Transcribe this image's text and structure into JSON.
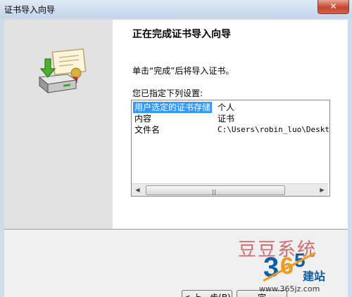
{
  "window": {
    "title": "证书导入向导",
    "close_glyph": "✕"
  },
  "wizard": {
    "heading": "正在完成证书导入向导",
    "instruction": "单击“完成”后将导入证书。",
    "listbox_label": "您已指定下列设置:",
    "settings": [
      {
        "name": "用户选定的证书存储",
        "value": "个人",
        "selected": true
      },
      {
        "name": "内容",
        "value": "证书",
        "selected": false
      },
      {
        "name": "文件名",
        "value": "C:\\Users\\robin_luo\\Desktop\\",
        "selected": false
      }
    ],
    "icons": {
      "graphic": "certificate-import-icon",
      "scroll_left": "scroll-left-arrow-icon",
      "scroll_right": "scroll-right-arrow-icon"
    }
  },
  "buttons": {
    "back": "< 上一步(B)",
    "finish": "完"
  },
  "watermark": {
    "title": "豆豆系统",
    "brand": "建站",
    "url": "www.365jz.com",
    "colors": {
      "title": "#c8565a",
      "brand": "#0d5fa6",
      "logo_orange": "#f29a1f"
    }
  },
  "colors": {
    "selection": "#3399ff",
    "left_panel": "#e2e2e2",
    "window_frame": "#cfdcec",
    "close_button": "#c8452f"
  }
}
